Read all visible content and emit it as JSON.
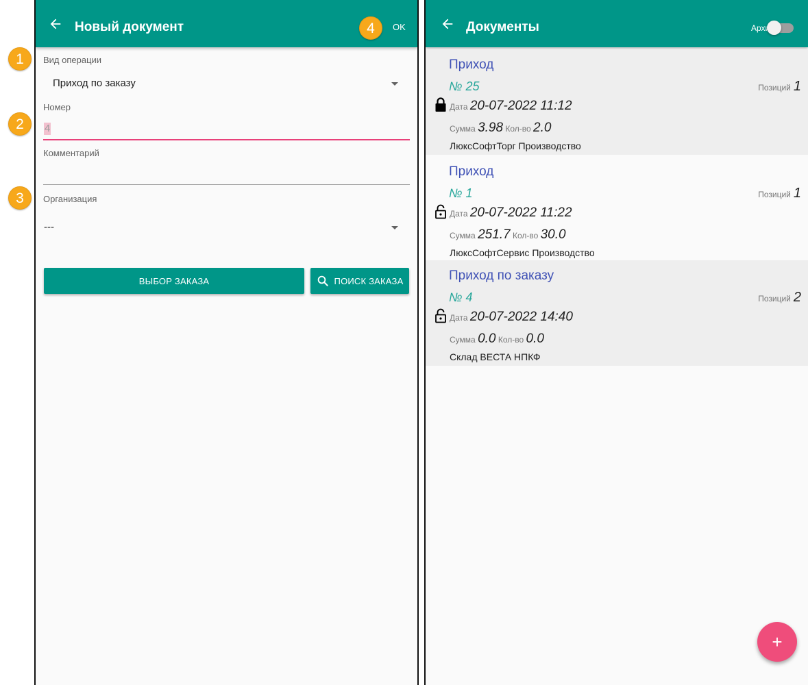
{
  "left_screen": {
    "title": "Новый документ",
    "ok_label": "OK",
    "operation": {
      "label": "Вид операции",
      "value": "Приход по заказу"
    },
    "number": {
      "label": "Номер",
      "value": "4"
    },
    "comment": {
      "label": "Комментарий",
      "value": ""
    },
    "organization": {
      "label": "Организация",
      "value": "---"
    },
    "buttons": {
      "select_order": "ВЫБОР ЗАКАЗА",
      "search_order": "ПОИСК ЗАКАЗА"
    }
  },
  "badges": [
    "1",
    "2",
    "3",
    "4"
  ],
  "right_screen": {
    "title": "Документы",
    "archive_label": "Архив",
    "archive_enabled": false,
    "documents": [
      {
        "type": "Приход",
        "number": "№ 25",
        "positions_label": "Позиций",
        "positions": "1",
        "locked": true,
        "date_label": "Дата",
        "date": "20-07-2022 11:12",
        "sum_label": "Сумма",
        "sum": "3.98",
        "qty_label": "Кол-во",
        "qty": "2.0",
        "organization": "ЛюксСофтТорг Производство"
      },
      {
        "type": "Приход",
        "number": "№ 1",
        "positions_label": "Позиций",
        "positions": "1",
        "locked": false,
        "date_label": "Дата",
        "date": "20-07-2022 11:22",
        "sum_label": "Сумма",
        "sum": "251.7",
        "qty_label": "Кол-во",
        "qty": "30.0",
        "organization": "ЛюксСофтСервис Производство"
      },
      {
        "type": "Приход по заказу",
        "number": "№ 4",
        "positions_label": "Позиций",
        "positions": "2",
        "locked": false,
        "date_label": "Дата",
        "date": "20-07-2022 14:40",
        "sum_label": "Сумма",
        "sum": "0.0",
        "qty_label": "Кол-во",
        "qty": "0.0",
        "organization": "Склад ВЕСТА НПКФ"
      }
    ],
    "fab_label": "+"
  },
  "colors": {
    "primary": "#009688",
    "accent": "#ef4d7b",
    "doc_type": "#3f51b5",
    "doc_number": "#26a69a",
    "badge": "#f7a81b"
  }
}
